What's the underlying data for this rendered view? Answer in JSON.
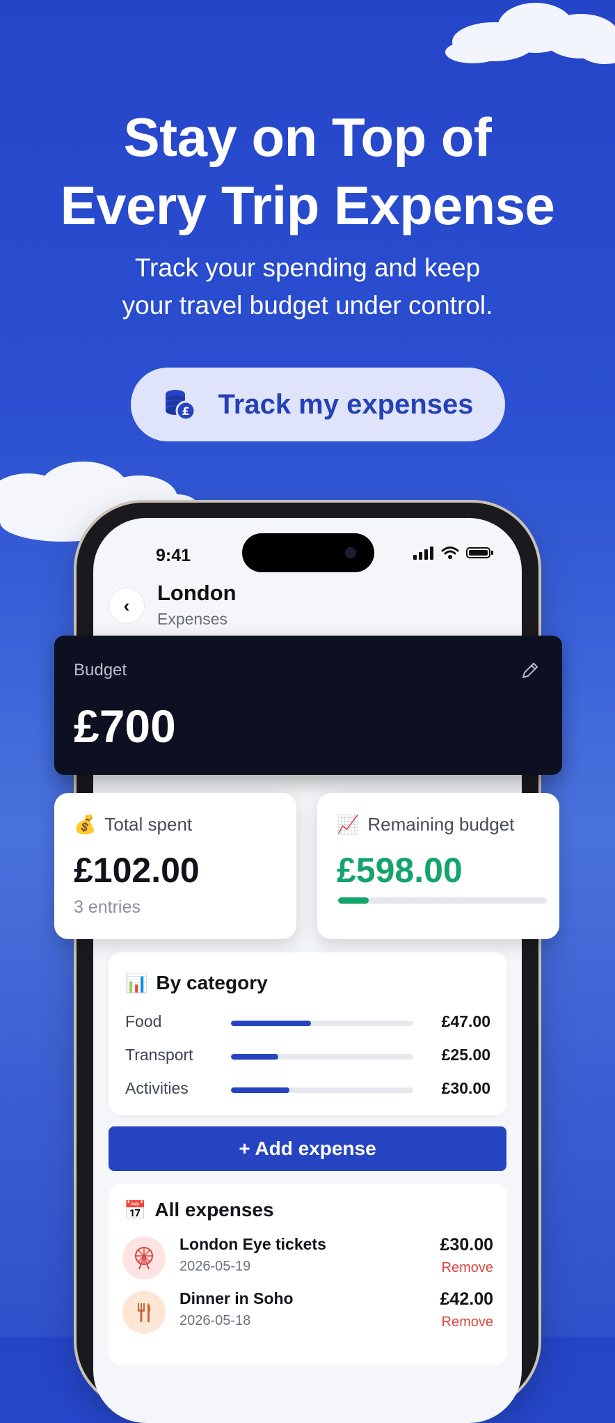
{
  "hero": {
    "title_line1": "Stay on Top of",
    "title_line2": "Every Trip Expense",
    "subtitle_line1": "Track your spending and keep",
    "subtitle_line2": "your travel budget under control.",
    "cta_label": "Track my expenses",
    "cta_icon": "coins-pound-icon"
  },
  "status_bar": {
    "time": "9:41"
  },
  "header": {
    "title": "London",
    "subtitle": "Expenses",
    "back_icon": "chevron-left-icon"
  },
  "budget": {
    "label": "Budget",
    "value": "£700",
    "edit_icon": "pencil-icon"
  },
  "total_spent": {
    "emoji": "💰",
    "label": "Total spent",
    "value": "£102.00",
    "note": "3 entries"
  },
  "remaining": {
    "emoji": "📈",
    "label": "Remaining budget",
    "value": "£598.00",
    "bar_fraction": 0.146
  },
  "by_category": {
    "emoji": "📊",
    "title": "By category",
    "rows": [
      {
        "name": "Food",
        "amount": "£47.00",
        "fraction": 0.44
      },
      {
        "name": "Transport",
        "amount": "£25.00",
        "fraction": 0.26
      },
      {
        "name": "Activities",
        "amount": "£30.00",
        "fraction": 0.32
      }
    ]
  },
  "add_expense": {
    "label": "+ Add expense"
  },
  "all_expenses": {
    "emoji": "📅",
    "title": "All expenses",
    "items": [
      {
        "title": "London Eye tickets",
        "date": "2026-05-19",
        "amount": "£30.00",
        "remove": "Remove",
        "icon": "ferris-wheel-icon"
      },
      {
        "title": "Dinner in Soho",
        "date": "2026-05-18",
        "amount": "£42.00",
        "remove": "Remove",
        "icon": "fork-knife-icon"
      }
    ]
  },
  "colors": {
    "accent": "#2644c2",
    "positive": "#13a56b",
    "danger": "#e0443b",
    "dark_card": "#0c1021"
  }
}
